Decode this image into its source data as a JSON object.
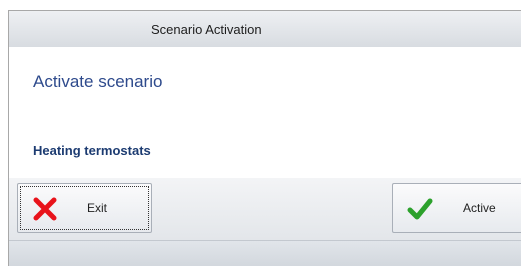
{
  "window": {
    "title": "Scenario Activation"
  },
  "content": {
    "heading": "Activate scenario",
    "scenario_name": "Heating termostats"
  },
  "buttons": {
    "exit": {
      "label": "Exit",
      "icon": "close-x-icon",
      "color": "#e8131b"
    },
    "active": {
      "label": "Active",
      "icon": "checkmark-icon",
      "color": "#2ca12c"
    }
  }
}
